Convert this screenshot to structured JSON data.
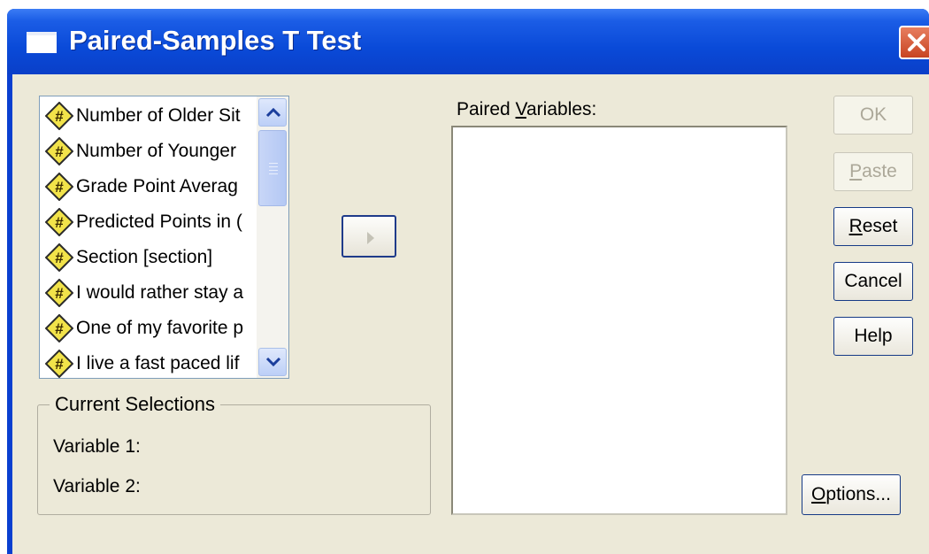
{
  "window": {
    "title": "Paired-Samples T Test",
    "icons": {
      "title": "window-icon",
      "close": "close-icon"
    }
  },
  "variables_list": {
    "items": [
      {
        "label": "Number of Older Sit",
        "icon": "numeric-variable-icon"
      },
      {
        "label": "Number of Younger",
        "icon": "numeric-variable-icon"
      },
      {
        "label": "Grade Point Averag",
        "icon": "numeric-variable-icon"
      },
      {
        "label": "Predicted Points in (",
        "icon": "numeric-variable-icon"
      },
      {
        "label": "Section [section]",
        "icon": "numeric-variable-icon"
      },
      {
        "label": "I would rather stay a",
        "icon": "numeric-variable-icon"
      },
      {
        "label": "One of my favorite p",
        "icon": "numeric-variable-icon"
      },
      {
        "label": "I live a fast paced lif",
        "icon": "numeric-variable-icon"
      }
    ],
    "scrollbar_icons": {
      "up": "chevron-up-icon",
      "down": "chevron-down-icon"
    }
  },
  "move_button": {
    "icon": "arrow-right-icon",
    "enabled": false
  },
  "paired_variables": {
    "label_before": "Paired ",
    "label_mnemonic": "V",
    "label_after": "ariables:"
  },
  "current_selections": {
    "title": "Current Selections",
    "variable1_label": "Variable 1:",
    "variable2_label": "Variable 2:"
  },
  "buttons": {
    "ok": {
      "label": "OK",
      "enabled": false
    },
    "paste": {
      "label_mnemonic": "P",
      "label_rest": "aste",
      "enabled": false
    },
    "reset": {
      "label_mnemonic": "R",
      "label_rest": "eset",
      "enabled": true
    },
    "cancel": {
      "label": "Cancel",
      "enabled": true
    },
    "help": {
      "label": "Help",
      "enabled": true
    },
    "options": {
      "label_mnemonic": "O",
      "label_rest": "ptions...",
      "enabled": true
    }
  },
  "colors": {
    "titlebar": "#0a4ad8",
    "dialog_face": "#ece9d8",
    "close_button": "#c84422",
    "variable_icon": "#f2e34a"
  }
}
